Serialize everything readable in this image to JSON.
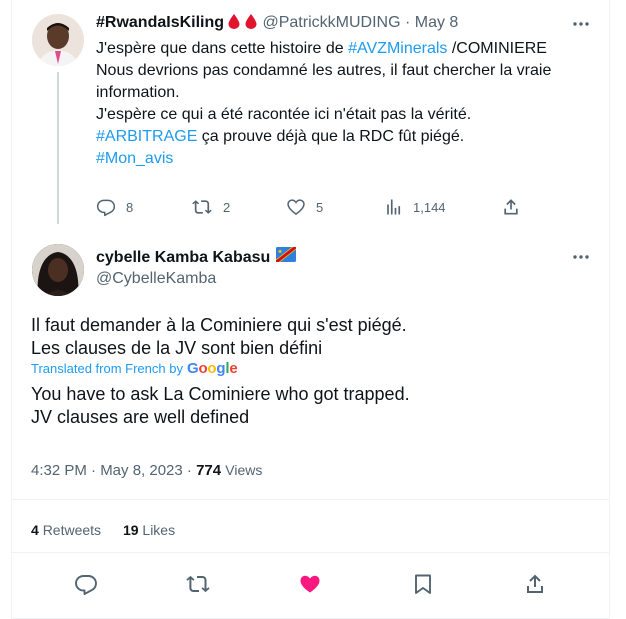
{
  "reply": {
    "display_name": "#RwandaIsKiling",
    "handle": "@PatrickkMUDING",
    "separator": "·",
    "date": "May 8",
    "body": {
      "line1_pre": "J'espère que dans cette histoire de ",
      "line1_tag": "#AVZMinerals",
      "line1_post": " /COMINIERE",
      "line2": "Nous devrions pas condamné les autres, il faut chercher la vraie information.",
      "line3": "J'espère ce qui a été racontée ici n'était pas la vérité.",
      "line4_tag": "#ARBITRAGE",
      "line4_post": " ça prouve déjà que la RDC fût piégé.",
      "line5_tag": "#Mon_avis"
    },
    "actions": {
      "replies": "8",
      "retweets": "2",
      "likes": "5",
      "views": "1,144"
    }
  },
  "main": {
    "display_name": "cybelle Kamba Kabasu",
    "handle": "@CybelleKamba",
    "original_text": {
      "line1": "Il faut demander à la Cominiere qui s'est piégé.",
      "line2": "Les clauses de la JV sont bien défini"
    },
    "translated_label": "Translated from French by",
    "translation_provider": "Google",
    "translation": {
      "line1": "You have to ask La Cominiere who got trapped.",
      "line2": "JV clauses are well defined"
    },
    "timestamp": "4:32 PM · May 8, 2023",
    "meta_sep": " · ",
    "views_count": "774",
    "views_label": "Views",
    "stats": {
      "retweets_count": "4",
      "retweets_label": "Retweets",
      "likes_count": "19",
      "likes_label": "Likes"
    }
  },
  "icons": {
    "reply": "reply-icon",
    "retweet": "retweet-icon",
    "like": "heart-icon",
    "views": "views-icon",
    "share": "share-icon",
    "bookmark": "bookmark-icon",
    "more": "more-icon",
    "blood_drop": "blood-drop-icon",
    "flag": "drc-flag-icon"
  },
  "colors": {
    "accent": "#1d9bf0",
    "text": "#0f1419",
    "secondary": "#536471",
    "liked": "#f91880",
    "drop": "#e0142d"
  }
}
